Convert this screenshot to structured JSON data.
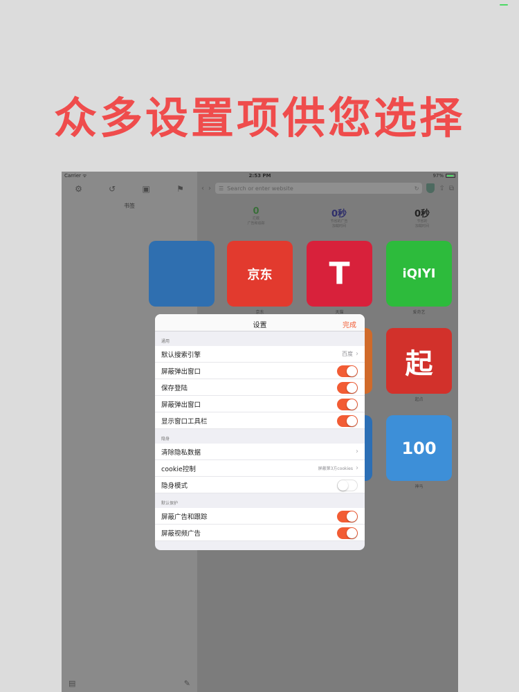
{
  "headline": "众多设置项供您选择",
  "statusbar": {
    "carrier": "Carrier ᯤ",
    "time": "2:53 PM",
    "battery": "97%"
  },
  "sidebar": {
    "title": "书签",
    "tools": [
      "settings-icon",
      "history-icon",
      "save-icon",
      "bookmark-icon"
    ],
    "bottom": [
      "folder-icon",
      "edit-icon"
    ]
  },
  "browser": {
    "search_placeholder": "Search or enter website",
    "stats": [
      {
        "value": "0",
        "label1": "拦截",
        "label2": "广告和追踪"
      },
      {
        "value": "0秒",
        "label1": "节省的广告",
        "label2": "加载时间"
      },
      {
        "value": "0秒",
        "label1": "节省的",
        "label2": "加载时间"
      }
    ],
    "tiles": [
      {
        "text": "京东",
        "label": "京东",
        "color": "#e23a2e"
      },
      {
        "text": "T",
        "label": "天猫",
        "color": "#d8213b"
      },
      {
        "text": "iQIYI",
        "label": "爱奇艺",
        "color": "#2dbb3c"
      },
      {
        "text": "起",
        "label": "起点",
        "color": "#d2312b"
      },
      {
        "text": "100",
        "label": "神马",
        "color": "#3d8fd8"
      }
    ]
  },
  "settings": {
    "title": "设置",
    "done": "完成",
    "sections": [
      {
        "header": "通用",
        "rows": [
          {
            "label": "默认搜索引擎",
            "detail": "百度",
            "type": "nav"
          },
          {
            "label": "屏蔽弹出窗口",
            "type": "toggle",
            "on": true
          },
          {
            "label": "保存登陆",
            "type": "toggle",
            "on": true
          },
          {
            "label": "屏蔽弹出窗口",
            "type": "toggle",
            "on": true
          },
          {
            "label": "显示窗口工具栏",
            "type": "toggle",
            "on": true
          }
        ]
      },
      {
        "header": "隐身",
        "rows": [
          {
            "label": "清除隐私数据",
            "detail": "",
            "type": "nav"
          },
          {
            "label": "cookie控制",
            "detail": "屏蔽第3方cookies",
            "type": "nav"
          },
          {
            "label": "隐身模式",
            "type": "toggle",
            "on": false
          }
        ]
      },
      {
        "header": "默认保护",
        "rows": [
          {
            "label": "屏蔽广告和跟踪",
            "type": "toggle",
            "on": true
          },
          {
            "label": "屏蔽视频广告",
            "type": "toggle",
            "on": true
          }
        ]
      }
    ]
  },
  "colors": {
    "accent": "#f25c34",
    "headline": "#ef4c4c"
  }
}
